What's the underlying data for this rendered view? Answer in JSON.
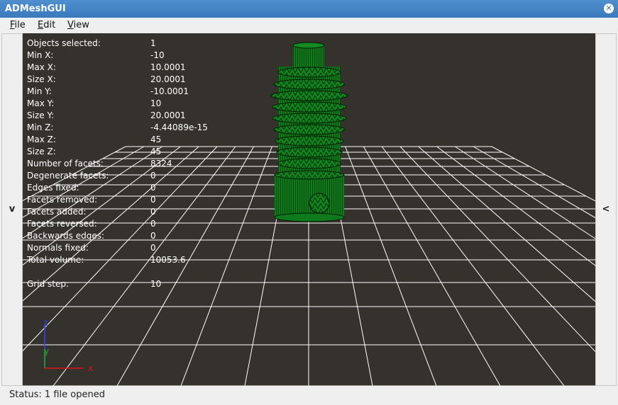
{
  "window": {
    "title": "ADMeshGUI"
  },
  "menu": [
    {
      "label": "File"
    },
    {
      "label": "Edit"
    },
    {
      "label": "View"
    }
  ],
  "left_toggle": {
    "label": "v"
  },
  "right_toggle": {
    "label": "<"
  },
  "info": [
    {
      "label": "Objects selected:",
      "value": "1"
    },
    {
      "label": "Min X:",
      "value": "-10"
    },
    {
      "label": "Max X:",
      "value": "10.0001"
    },
    {
      "label": "Size X:",
      "value": "20.0001"
    },
    {
      "label": "Min Y:",
      "value": "-10.0001"
    },
    {
      "label": "Max Y:",
      "value": "10"
    },
    {
      "label": "Size Y:",
      "value": "20.0001"
    },
    {
      "label": "Min Z:",
      "value": "-4.44089e-15"
    },
    {
      "label": "Max Z:",
      "value": "45"
    },
    {
      "label": "Size Z:",
      "value": "45"
    },
    {
      "label": "Number of facets:",
      "value": "8324"
    },
    {
      "label": "Degenerate facets:",
      "value": "0"
    },
    {
      "label": "Edges fixed:",
      "value": "0"
    },
    {
      "label": "Facets removed:",
      "value": "0"
    },
    {
      "label": "Facets added:",
      "value": "0"
    },
    {
      "label": "Facets reversed:",
      "value": "0"
    },
    {
      "label": "Backwards edges:",
      "value": "0"
    },
    {
      "label": "Normals fixed:",
      "value": "0"
    },
    {
      "label": "Total volume:",
      "value": "10053.6"
    }
  ],
  "grid_step": {
    "label": "Grid step:",
    "value": "10"
  },
  "axes": {
    "z": "z",
    "y": "y",
    "x": "x"
  },
  "status": {
    "text": "Status: 1 file opened"
  },
  "colors": {
    "viewport_bg": "#35322e",
    "grid": "#ffffff",
    "model": "#0f7a1c",
    "model_edge": "#001a00",
    "axis_x": "#d11",
    "axis_y": "#2a2",
    "axis_z": "#33f"
  }
}
